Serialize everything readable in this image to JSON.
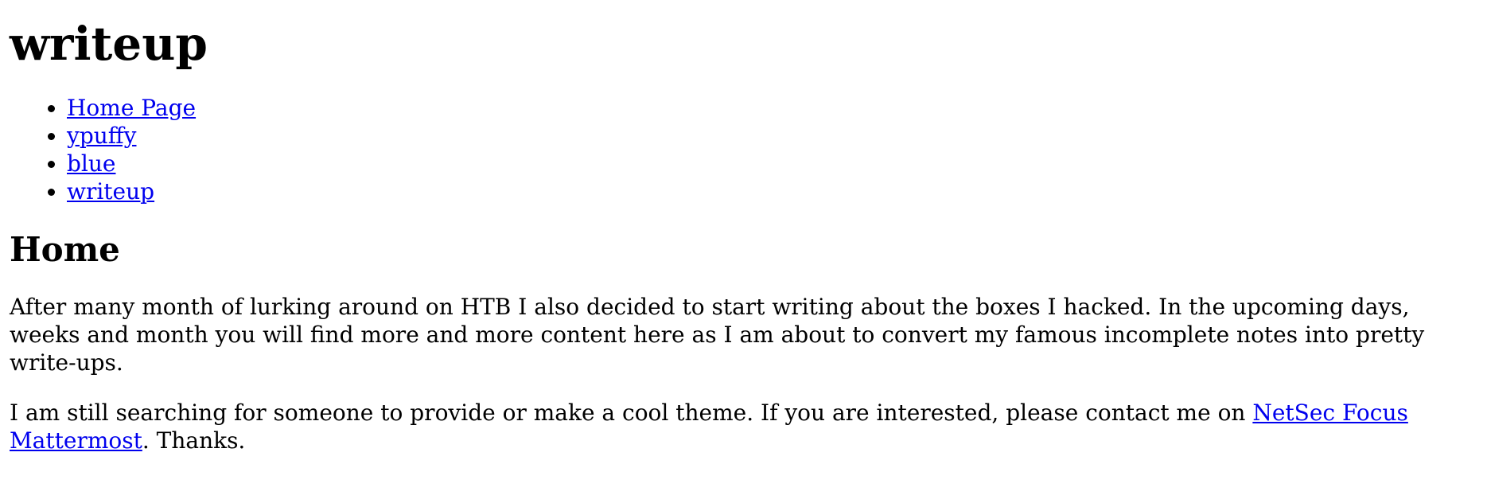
{
  "site": {
    "title": "writeup"
  },
  "nav": {
    "items": [
      {
        "label": "Home Page"
      },
      {
        "label": "ypuffy"
      },
      {
        "label": "blue"
      },
      {
        "label": "writeup"
      }
    ]
  },
  "main": {
    "heading": "Home",
    "paragraph1": "After many month of lurking around on HTB I also decided to start writing about the boxes I hacked. In the upcoming days, weeks and month you will find more and more content here as I am about to convert my famous incomplete notes into pretty write-ups.",
    "paragraph2_before": "I am still searching for someone to provide or make a cool theme. If you are interested, please contact me on ",
    "paragraph2_link": "NetSec Focus Mattermost",
    "paragraph2_after": ". Thanks."
  },
  "colors": {
    "link": "#0000ee",
    "text": "#000000",
    "background": "#ffffff"
  }
}
